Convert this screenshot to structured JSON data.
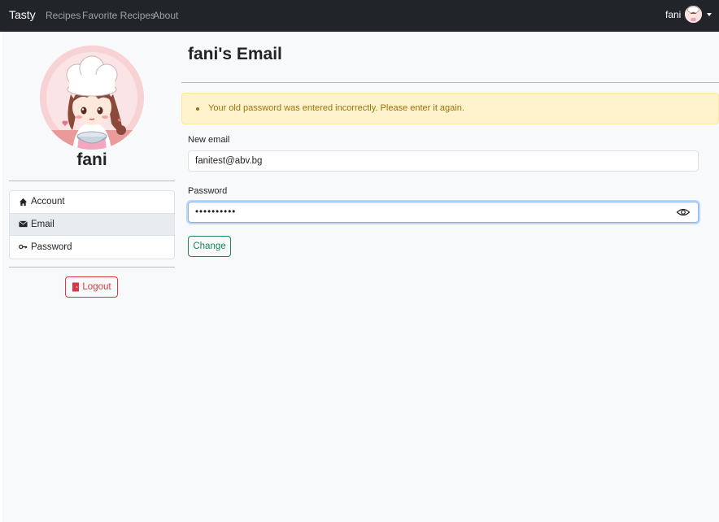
{
  "navbar": {
    "brand": "Tasty",
    "links": [
      "Recipes",
      "Favorite Recipes",
      "About"
    ],
    "username": "fani"
  },
  "sidebar": {
    "profile_name": "fani",
    "menu": [
      {
        "label": "Account",
        "icon": "house-icon"
      },
      {
        "label": "Email",
        "icon": "envelope-icon"
      },
      {
        "label": "Password",
        "icon": "key-icon"
      }
    ],
    "active_item": "Email",
    "logout_label": "Logout"
  },
  "main": {
    "title": "fani's Email",
    "alert": {
      "message": "Your old password was entered incorrectly. Please enter it again.",
      "type": "warning"
    },
    "form": {
      "email_label": "New email",
      "email_value": "fanitest@abv.bg",
      "password_label": "Password",
      "password_value": "••••••••••",
      "submit_label": "Change"
    }
  },
  "colors": {
    "navbar_bg": "#212529",
    "page_bg": "#f8f9fa",
    "alert_bg": "#fff3cd",
    "alert_text": "#997404",
    "danger": "#dc3545",
    "success": "#198754",
    "focus_ring": "#86b7fe"
  }
}
